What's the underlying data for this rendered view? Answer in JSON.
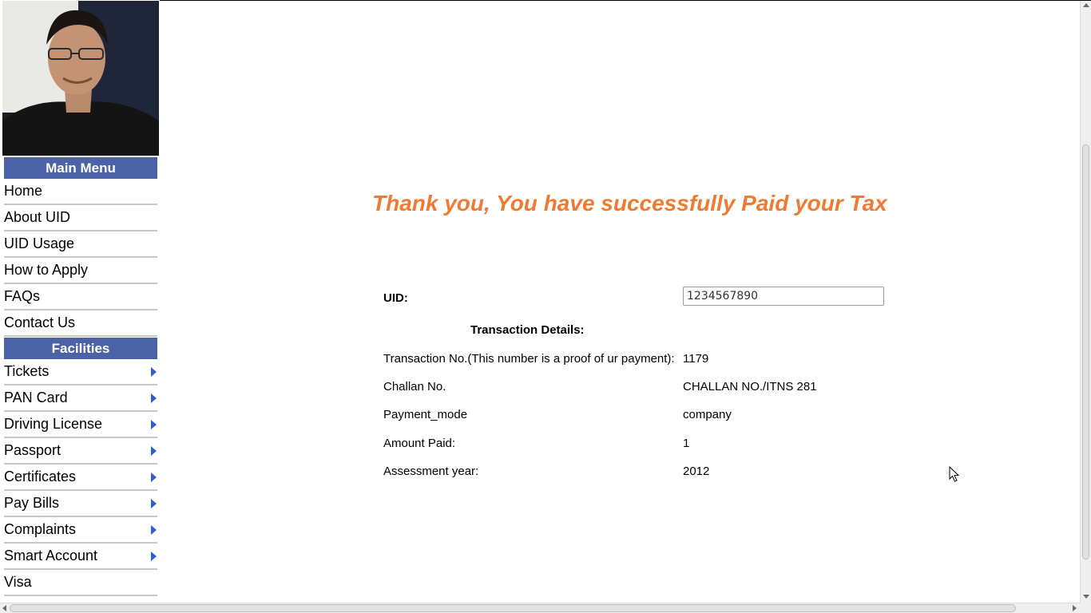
{
  "sidebar": {
    "main_menu_title": "Main Menu",
    "main_menu_items": [
      {
        "label": "Home"
      },
      {
        "label": "About UID"
      },
      {
        "label": "UID Usage"
      },
      {
        "label": "How to Apply"
      },
      {
        "label": "FAQs"
      },
      {
        "label": "Contact Us"
      }
    ],
    "facilities_title": "Facilities",
    "facilities_items": [
      {
        "label": "Tickets",
        "has_submenu": true
      },
      {
        "label": "PAN Card",
        "has_submenu": true
      },
      {
        "label": "Driving License",
        "has_submenu": true
      },
      {
        "label": "Passport",
        "has_submenu": true
      },
      {
        "label": "Certificates",
        "has_submenu": true
      },
      {
        "label": "Pay Bills",
        "has_submenu": true
      },
      {
        "label": "Complaints",
        "has_submenu": true
      },
      {
        "label": "Smart Account",
        "has_submenu": true
      },
      {
        "label": "Visa",
        "has_submenu": false
      }
    ]
  },
  "main": {
    "thank_you": "Thank you, You have successfully Paid your Tax",
    "uid_label": "UID:",
    "uid_value": "1234567890",
    "transaction_heading": "Transaction Details:",
    "details": [
      {
        "label": "Transaction No.(This number is a proof of ur payment):",
        "value": "1179"
      },
      {
        "label": "Challan No.",
        "value": "CHALLAN NO./ITNS 281"
      },
      {
        "label": "Payment_mode",
        "value": "company"
      },
      {
        "label": "Amount Paid:",
        "value": "1"
      },
      {
        "label": "Assessment year:",
        "value": "2012"
      }
    ]
  },
  "colors": {
    "menu_header_bg": "#4b63a6",
    "thank_you_text": "#ef7b33",
    "submenu_arrow": "#2a5fd6"
  }
}
